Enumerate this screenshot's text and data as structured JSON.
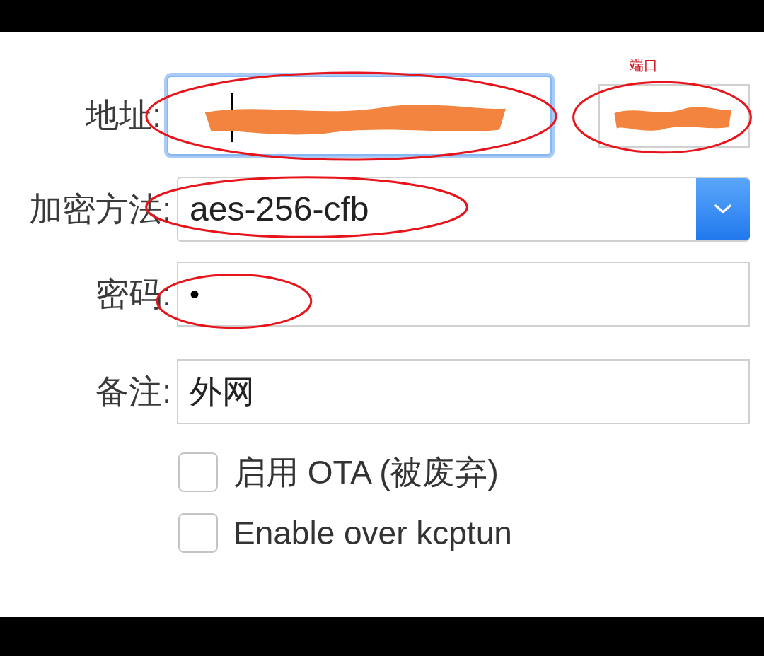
{
  "annotation_note": "端口",
  "form": {
    "address": {
      "label": "地址:",
      "focused": true,
      "redacted": true,
      "circled": true
    },
    "port": {
      "redacted": true,
      "circled": true
    },
    "method": {
      "label": "加密方法:",
      "value": "aes-256-cfb",
      "circled": true
    },
    "password": {
      "label": "密码:",
      "value": "•",
      "circled": true
    },
    "remark": {
      "label": "备注:",
      "value": "外网"
    }
  },
  "options": [
    {
      "label": "启用 OTA (被废弃)",
      "checked": false
    },
    {
      "label": "Enable over kcptun",
      "checked": false
    }
  ]
}
